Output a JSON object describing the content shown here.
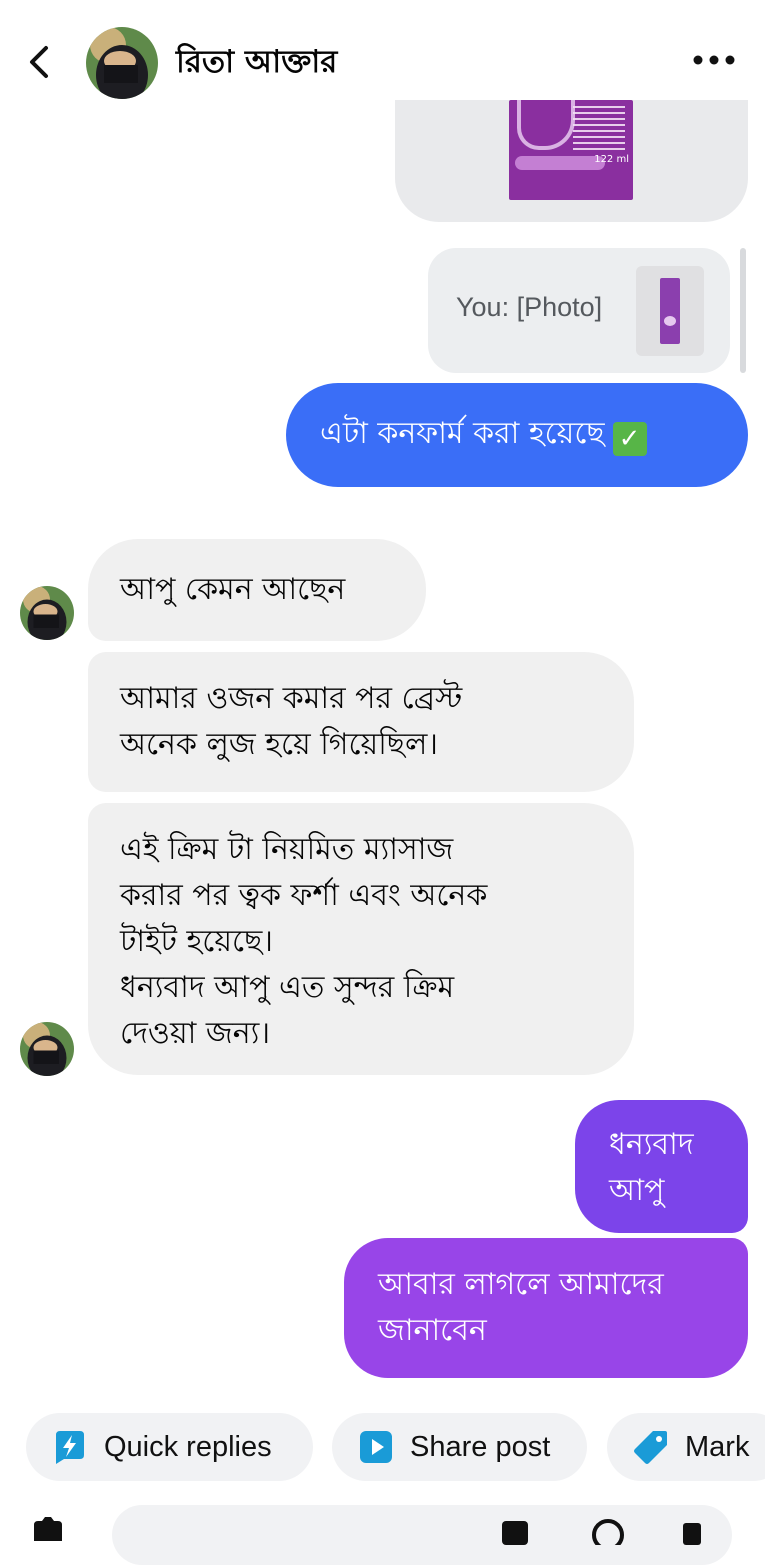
{
  "header": {
    "contact_name": "রিতা আক্তার",
    "back_icon": "chevron-left-icon",
    "more_icon": "more-horizontal-icon"
  },
  "shared_photo": {
    "volume_label": "122 ml"
  },
  "reply_preview": {
    "text": "You: [Photo]"
  },
  "messages": {
    "outgoing_1": {
      "text": "এটা কনফার্ম করা হয়েছে",
      "emoji": "✓"
    },
    "incoming_1": {
      "text": "আপু কেমন আছেন"
    },
    "incoming_2": {
      "lines": [
        "আমার ওজন কমার পর ব্রেস্ট",
        "অনেক লুজ হয়ে গিয়েছিল।"
      ]
    },
    "incoming_3": {
      "lines": [
        "এই ক্রিম টা নিয়মিত ম্যাসাজ",
        "করার পর ত্বক ফর্শা এবং অনেক",
        "টাইট হয়েছে।",
        "ধন্যবাদ আপু এত সুন্দর ক্রিম",
        "দেওয়া জন্য।"
      ]
    },
    "outgoing_2": {
      "lines": [
        "ধন্যবাদ",
        "আপু"
      ]
    },
    "outgoing_3": {
      "lines": [
        "আবার লাগলে আমাদের",
        "জানাবেন"
      ]
    }
  },
  "actions": {
    "quick_replies": "Quick replies",
    "share_post": "Share post",
    "mark": "Mark"
  },
  "colors": {
    "blue_bubble": "#3a6ef7",
    "purple_bubble_1": "#7c44ea",
    "purple_bubble_2": "#9845e8",
    "incoming_bubble": "#f0f0f0",
    "action_icon": "#1a9bd7"
  }
}
